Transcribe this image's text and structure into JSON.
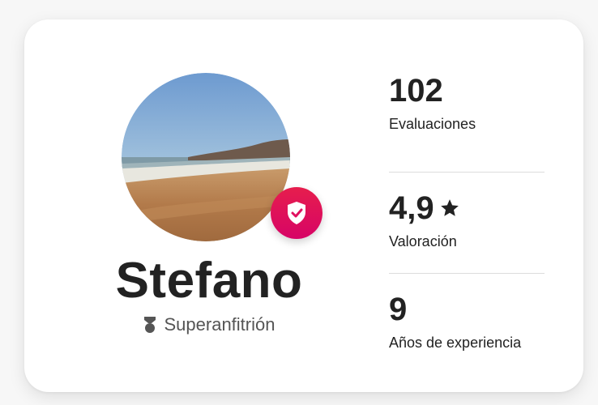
{
  "host": {
    "name": "Stefano",
    "badge_label": "Superanfitrión",
    "avatar_icon": "beach-photo",
    "verified_icon": "shield-check-icon",
    "badge_icon": "superhost-medal-icon"
  },
  "stats": [
    {
      "value": "102",
      "label": "Evaluaciones"
    },
    {
      "value": "4,9",
      "label": "Valoración",
      "icon": "star-icon"
    },
    {
      "value": "9",
      "label": "Años de experiencia"
    }
  ],
  "colors": {
    "accent": "#e61e4d",
    "text": "#222222",
    "muted": "#555555"
  }
}
